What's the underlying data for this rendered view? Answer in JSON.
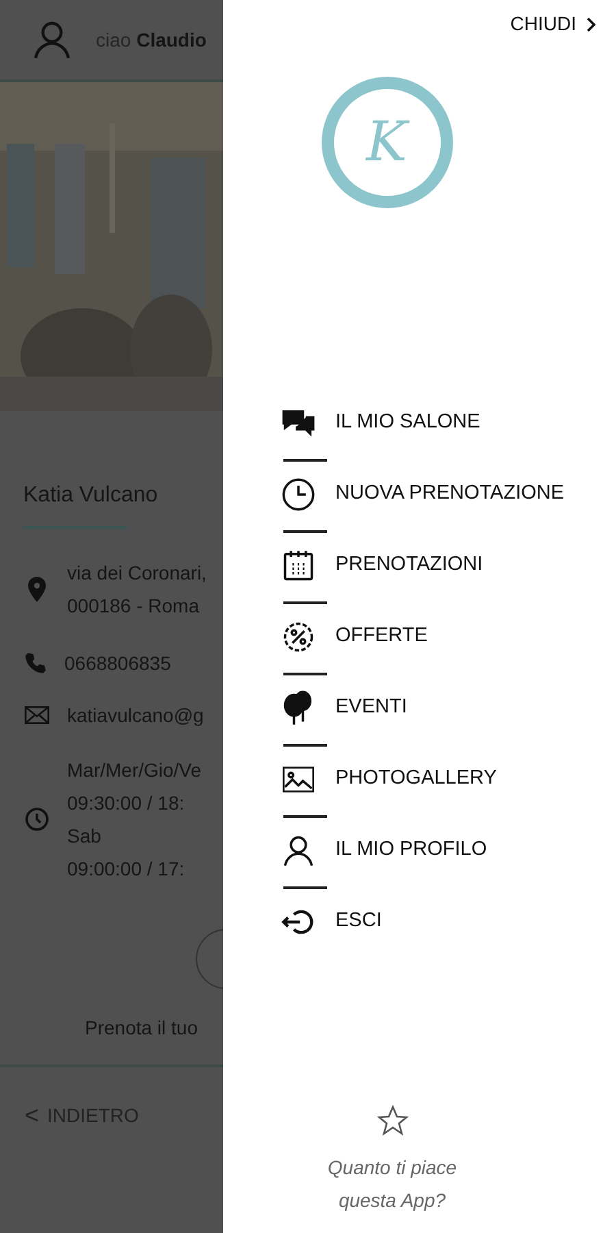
{
  "background_page": {
    "greeting": "ciao",
    "user_name": "Claudio",
    "salon_name": "Katia Vulcano",
    "address_lines": [
      "via dei Coronari,",
      "000186 - Roma"
    ],
    "phone": "0668806835",
    "email": "katiavulcano@g",
    "hours_lines": [
      "Mar/Mer/Gio/Ve",
      "09:30:00 / 18:",
      "Sab",
      "09:00:00 / 17:"
    ],
    "booking_text": "Prenota il tuo",
    "back_button": {
      "icon": "<",
      "label": "INDIETRO"
    }
  },
  "drawer": {
    "close_button": {
      "label": "CHIUDI"
    },
    "logo_letter": "K",
    "menu_items": [
      {
        "label": "IL MIO SALONE"
      },
      {
        "label": "NUOVA PRENOTAZIONE"
      },
      {
        "label": "PRENOTAZIONI"
      },
      {
        "label": "OFFERTE"
      },
      {
        "label": "EVENTI"
      },
      {
        "label": "PHOTOGALLERY"
      },
      {
        "label": "IL MIO PROFILO"
      },
      {
        "label": "ESCI"
      }
    ],
    "rating_prompt": {
      "lines": [
        "Quanto ti piace",
        "questa App?"
      ]
    }
  }
}
